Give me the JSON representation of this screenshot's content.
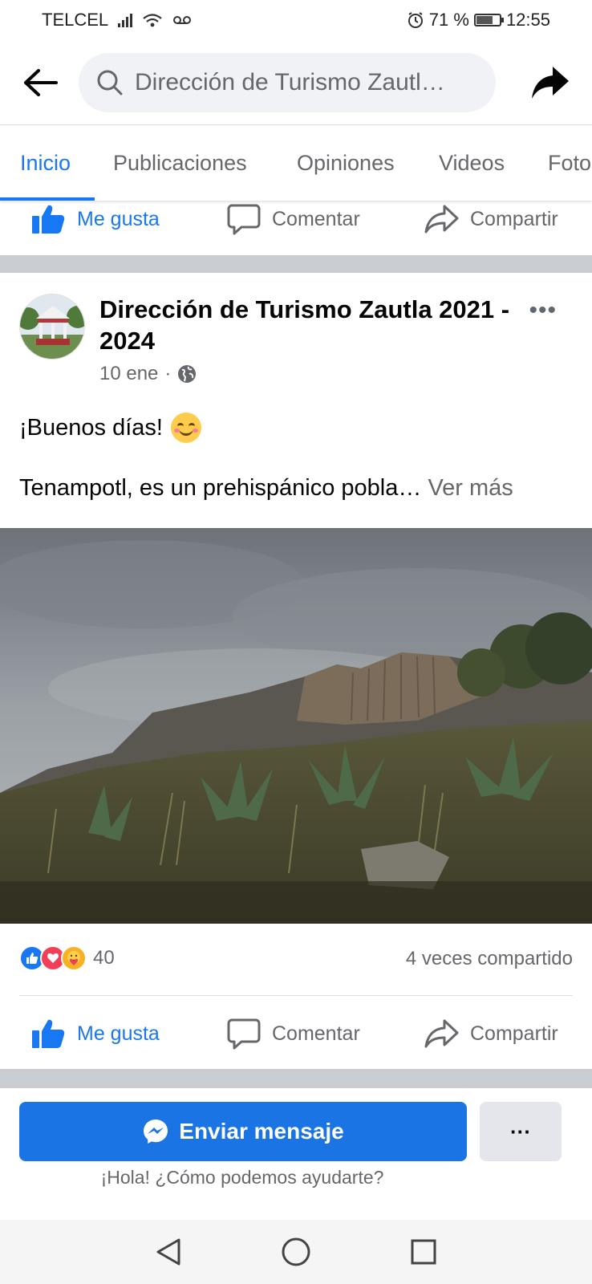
{
  "status_bar": {
    "carrier": "TELCEL",
    "battery_percent": "71 %",
    "battery_level": 0.71,
    "time": "12:55",
    "icons": [
      "signal-icon",
      "wifi-icon",
      "voicemail-icon",
      "alarm-icon",
      "battery-icon"
    ]
  },
  "header": {
    "search_text": "Dirección de Turismo Zautl…",
    "icons": [
      "back-arrow-icon",
      "search-icon",
      "share-arrow-icon"
    ]
  },
  "tabs": [
    {
      "label": "Inicio",
      "active": true
    },
    {
      "label": "Publicaciones",
      "active": false
    },
    {
      "label": "Opiniones",
      "active": false
    },
    {
      "label": "Videos",
      "active": false
    },
    {
      "label": "Fotos",
      "active": false
    }
  ],
  "top_actions": {
    "like": "Me gusta",
    "comment": "Comentar",
    "share": "Compartir"
  },
  "post": {
    "page_name": "Dirección de Turismo Zautla 2021 - 2024",
    "date": "10 ene",
    "separator": "·",
    "audience_icon": "globe-icon",
    "greeting_line": "¡Buenos días!",
    "greeting_emoji": "smiling-face-icon",
    "text_preview": "Tenampotl, es un prehispánico pobla…",
    "see_more": "Ver más",
    "reaction_icons": [
      "like-reaction-icon",
      "love-reaction-icon",
      "care-reaction-icon"
    ],
    "reaction_count": "40",
    "shares": "4 veces compartido",
    "actions": {
      "like": "Me gusta",
      "comment": "Comentar",
      "share": "Compartir"
    }
  },
  "message_bar": {
    "send_label": "Enviar mensaje",
    "more_label": "···",
    "greeting": "¡Hola! ¿Cómo podemos ayudarte?"
  },
  "nav_bar": {
    "icons": [
      "nav-back-icon",
      "nav-home-icon",
      "nav-recents-icon"
    ]
  },
  "colors": {
    "accent": "#1877f2",
    "button_blue": "#1b74e4",
    "secondary_text": "#65676b",
    "separator_band": "#c9ccd1"
  }
}
